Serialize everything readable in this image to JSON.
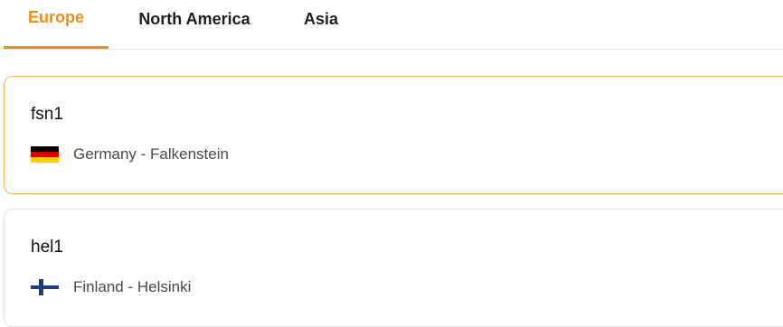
{
  "tabs": [
    {
      "label": "Europe",
      "active": true
    },
    {
      "label": "North America",
      "active": false
    },
    {
      "label": "Asia",
      "active": false
    }
  ],
  "locations": [
    {
      "code": "fsn1",
      "location": "Germany - Falkenstein",
      "flag_icon": "germany-flag-icon",
      "selected": true
    },
    {
      "code": "hel1",
      "location": "Finland - Helsinki",
      "flag_icon": "finland-flag-icon",
      "selected": false
    }
  ],
  "colors": {
    "accent": "#f08c1a",
    "selected_border": "#f0b35c",
    "border": "#e3e3e3"
  }
}
